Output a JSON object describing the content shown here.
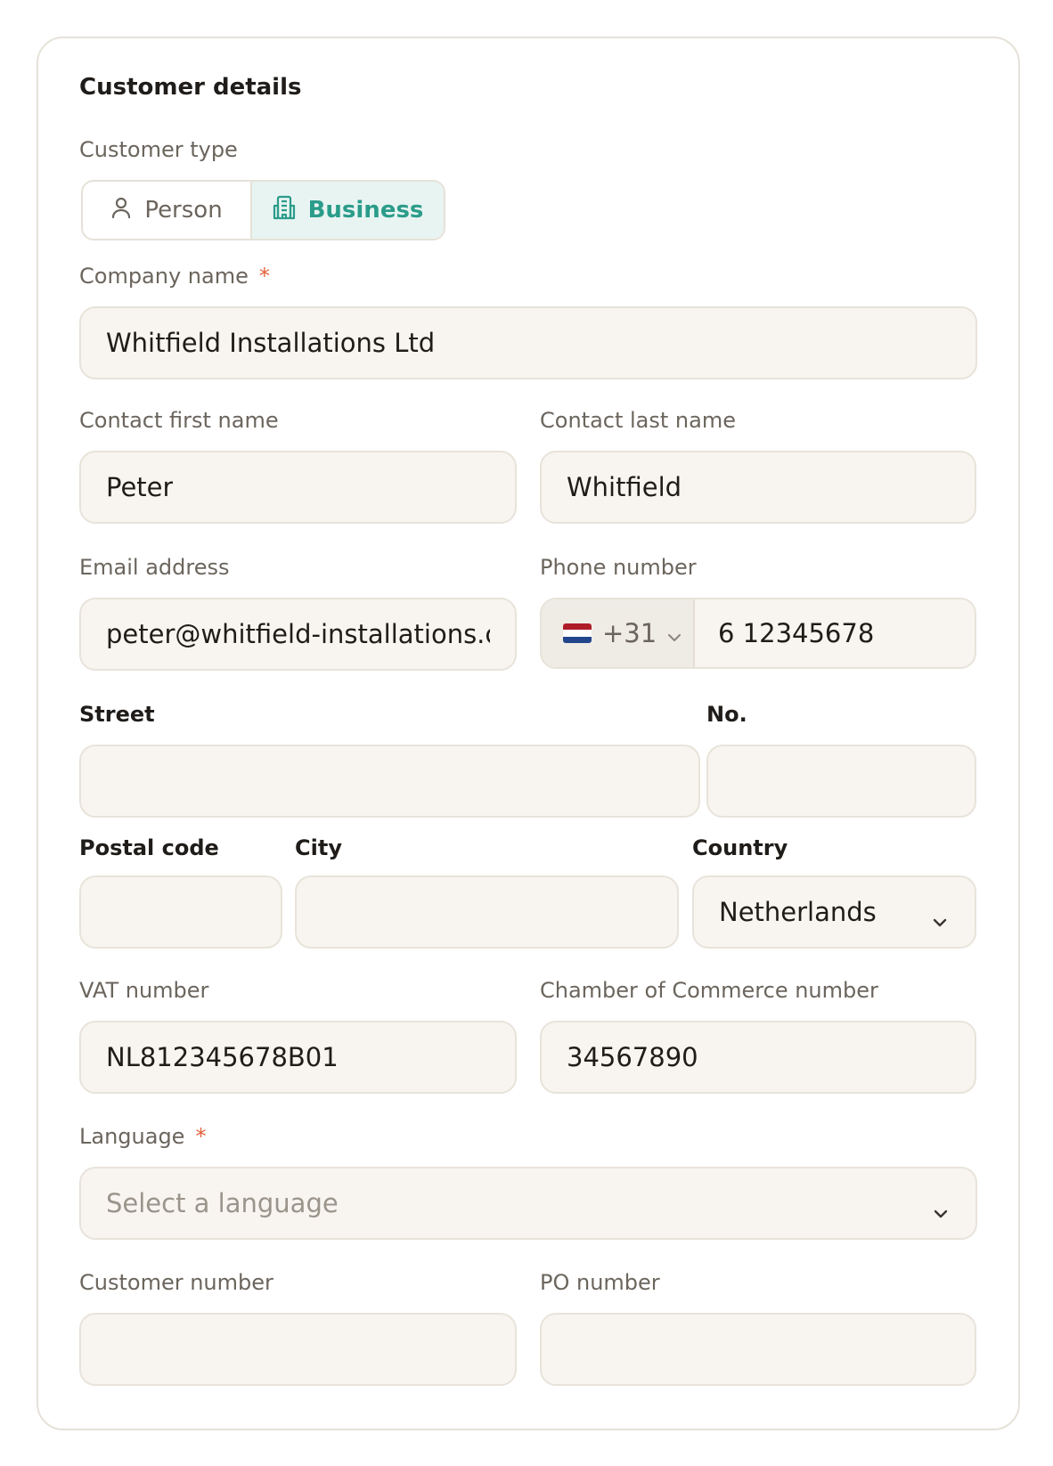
{
  "section": {
    "title": "Customer details"
  },
  "customer_type": {
    "label": "Customer type",
    "options": [
      {
        "label": "Person",
        "icon": "person-icon",
        "selected": false
      },
      {
        "label": "Business",
        "icon": "building-icon",
        "selected": true
      }
    ]
  },
  "company_name": {
    "label": "Company name",
    "required_mark": "*",
    "value": "Whitfield Installations Ltd"
  },
  "contact_first_name": {
    "label": "Contact first name",
    "value": "Peter"
  },
  "contact_last_name": {
    "label": "Contact last name",
    "value": "Whitfield"
  },
  "email": {
    "label": "Email address",
    "value": "peter@whitfield-installations.com"
  },
  "phone": {
    "label": "Phone number",
    "country_code": "+31",
    "flag": "netherlands-flag",
    "value": "6 12345678"
  },
  "street": {
    "label": "Street",
    "value": ""
  },
  "house_number": {
    "label": "No.",
    "value": ""
  },
  "postal_code": {
    "label": "Postal code",
    "value": ""
  },
  "city": {
    "label": "City",
    "value": ""
  },
  "country": {
    "label": "Country",
    "value": "Netherlands"
  },
  "vat_number": {
    "label": "VAT number",
    "value": "NL812345678B01"
  },
  "coc_number": {
    "label": "Chamber of Commerce number",
    "value": "34567890"
  },
  "language": {
    "label": "Language",
    "required_mark": "*",
    "placeholder": "Select a language"
  },
  "customer_number": {
    "label": "Customer number",
    "value": ""
  },
  "po_number": {
    "label": "PO number",
    "value": ""
  },
  "colors": {
    "accent": "#2a9c8a",
    "accent_bg": "#e8f4f2",
    "required": "#e2623a",
    "field_bg": "#f8f5f0",
    "border": "#e8e3da"
  }
}
